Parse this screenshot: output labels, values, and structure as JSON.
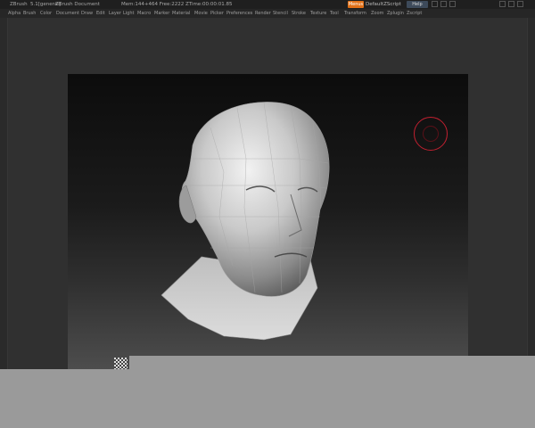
{
  "titlebar": {
    "app": "ZBrush",
    "version": "5.1[general]",
    "doc": "ZBrush Document",
    "stats": "Mem:144+464  Free:2222  ZTime:00:00:01.85",
    "menus_button": "Menus",
    "script_name": "DefaultZScript",
    "help_button": "Help"
  },
  "menubar": {
    "items": [
      "Alpha",
      "Brush",
      "Color",
      "Document",
      "Draw",
      "Edit",
      "Layer",
      "Light",
      "Macro",
      "Marker",
      "Material",
      "Movie",
      "Picker",
      "Preferences",
      "Render",
      "Stencil",
      "Stroke",
      "Texture",
      "Tool",
      "Transform",
      "Zoom",
      "Zplugin",
      "Zscript"
    ]
  },
  "colors": {
    "accent": "#e07018",
    "brush_ring": "#c02030",
    "panel": "#9a9a9a"
  },
  "icons": {
    "brush_cursor": "brush-ring-icon",
    "navigation": "checker-nav-icon"
  }
}
